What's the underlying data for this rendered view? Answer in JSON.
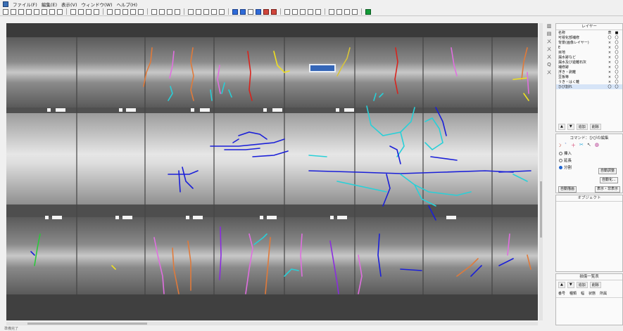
{
  "menu": {
    "items": [
      "ファイル(F)",
      "編集(E)",
      "表示(V)",
      "ウィンドウ(W)",
      "ヘルプ(H)"
    ]
  },
  "toolbar": {
    "icons": [
      "new-file-icon",
      "open-folder-icon",
      "save-icon",
      "print-icon",
      "cut-icon",
      "copy-icon",
      "paste-icon",
      "printer-icon",
      "sep",
      "rect-icon",
      "grid-icon",
      "grid-icon",
      "grid-icon",
      "sep",
      "window-icon",
      "window-icon",
      "zoom-in-icon",
      "zoom-out-icon",
      "pan-icon",
      "sep",
      "pointer-icon",
      "select-icon",
      "link-icon",
      "text-icon",
      "sep",
      "layout-icon",
      "layout-icon",
      "layout-icon",
      "layout-icon",
      "layout-icon",
      "sep",
      "image-icon",
      "image-icon",
      "list-icon",
      "image-icon",
      "chart-icon",
      "chart-icon",
      "sep",
      "rotate-icon",
      "table-icon",
      "table-icon",
      "camera-icon",
      "gear-icon",
      "sep",
      "export-icon",
      "map-icon",
      "tool-icon",
      "window-icon",
      "sep",
      "stop-icon"
    ]
  },
  "sidebar_tools": [
    "▥",
    "▤",
    "ㄨ",
    "ㄨ",
    "ㄨ",
    "Q",
    "ㄨ"
  ],
  "layer_panel": {
    "title": "レイヤー",
    "header": {
      "name": "名称",
      "c1": "表",
      "c2": "■"
    },
    "rows": [
      {
        "name": "可視化部補修",
        "c1": "〇",
        "c2": "〇"
      },
      {
        "name": "背景(画像レイヤー)",
        "c1": "×",
        "c2": "〇"
      },
      {
        "name": "E",
        "c1": "×",
        "c2": "〇"
      },
      {
        "name": "目地",
        "c1": "×",
        "c2": "〇"
      },
      {
        "name": "漏水跡など",
        "c1": "×",
        "c2": "〇"
      },
      {
        "name": "漏水及び遊離石灰",
        "c1": "×",
        "c2": "〇"
      },
      {
        "name": "補修跡",
        "c1": "×",
        "c2": "〇"
      },
      {
        "name": "浮き・剥離",
        "c1": "×",
        "c2": "〇"
      },
      {
        "name": "豆板等",
        "c1": "×",
        "c2": "〇"
      },
      {
        "name": "うき・はく離",
        "c1": "×",
        "c2": "〇"
      },
      {
        "name": "ひび割れ",
        "c1": "〇",
        "c2": "〇"
      }
    ],
    "tabs": [
      "▲",
      "▼",
      "追加",
      "削除"
    ]
  },
  "command_panel": {
    "title": "コマンド：ひびの編集",
    "options": [
      {
        "label": "挿入",
        "selected": false
      },
      {
        "label": "延長",
        "selected": false
      },
      {
        "label": "分割",
        "selected": true
      }
    ],
    "buttons": [
      "自動描画",
      "自動調整",
      "自動化...",
      "表示・非表示"
    ]
  },
  "object_panel": {
    "title": "オブジェクト"
  },
  "bottom_panel": {
    "title": "損傷一覧表",
    "columns": [
      "番号",
      "種類",
      "幅",
      "状態",
      "所属"
    ],
    "tabs": [
      "▲",
      "▼",
      "追加",
      "削除"
    ]
  },
  "status": {
    "text": "準備完了"
  },
  "colors": {
    "crack_blue": "#1a1fd8",
    "crack_cyan": "#28d0d8",
    "crack_red": "#d8231c",
    "crack_orange": "#e07a3a",
    "crack_pink": "#e06fe0",
    "crack_purple": "#8a2be0",
    "crack_yellow": "#f0e020",
    "crack_green": "#2ac83a"
  }
}
